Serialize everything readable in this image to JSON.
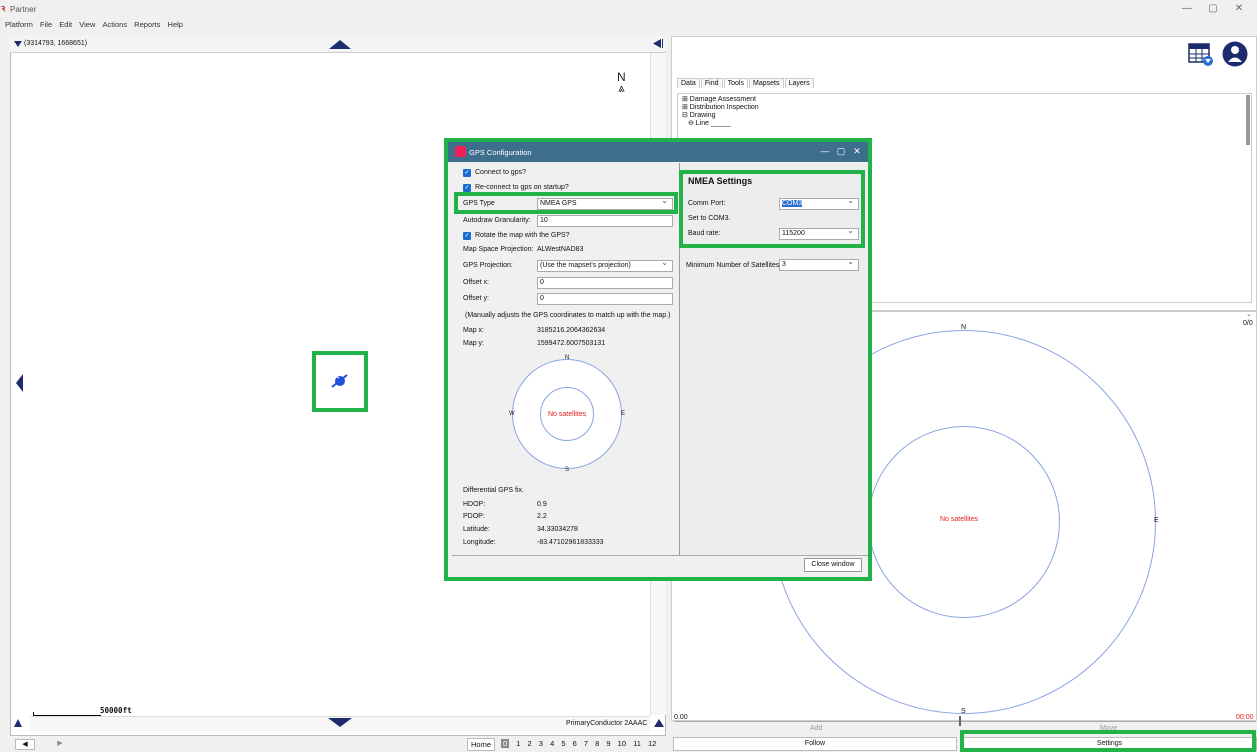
{
  "app": {
    "title": "Partner",
    "menu": [
      "Platform",
      "File",
      "Edit",
      "View",
      "Actions",
      "Reports",
      "Help"
    ],
    "window_controls": {
      "minimize": "—",
      "restore": "▢",
      "close": "✕"
    }
  },
  "map": {
    "coords": "(3314793, 1668651)",
    "north": "N",
    "scale": "50000ft",
    "layer": "PrimaryConductor 2AAAC",
    "home": "Home",
    "pages": [
      "0",
      "1",
      "2",
      "3",
      "4",
      "5",
      "6",
      "7",
      "8",
      "9",
      "10",
      "11",
      "12"
    ],
    "active_page": "0"
  },
  "tools": {
    "tabs": [
      "Data",
      "Find",
      "Tools",
      "Mapsets",
      "Layers"
    ],
    "active_tab": "Tools",
    "tree": [
      "⊞ Damage Assessment",
      "⊞ Distribution Inspection",
      "⊟ Drawing",
      "  ⊖ Line _____"
    ]
  },
  "skyplot_large": {
    "n": "N",
    "s": "S",
    "e": "E",
    "no_sat": "No satellites",
    "count": "0/0",
    "left_val": "0.00",
    "right_val": "00:00",
    "add": "Add",
    "move": "Move",
    "follow": "Follow",
    "settings": "Settings"
  },
  "dialog": {
    "title": "GPS Configuration",
    "connect": "Connect to gps?",
    "reconnect": "Re-connect to gps on startup?",
    "gps_type_label": "GPS Type",
    "gps_type_value": "NMEA GPS",
    "autodraw_label": "Autodraw Granularity:",
    "autodraw_value": "10",
    "rotate": "Rotate the map with the GPS?",
    "map_proj_label": "Map Space Projection:",
    "map_proj_value": "ALWestNAD83",
    "gps_proj_label": "GPS Projection:",
    "gps_proj_value": "(Use the mapset's projection)",
    "offset_x_label": "Offset x:",
    "offset_x_value": "0",
    "offset_y_label": "Offset y:",
    "offset_y_value": "0",
    "offset_note": "(Manually adjusts the GPS coordinates to match up with the map.)",
    "map_x_label": "Map x:",
    "map_x_value": "3185216.2064362634",
    "map_y_label": "Map y:",
    "map_y_value": "1599472.6007503131",
    "sky": {
      "n": "N",
      "s": "S",
      "e": "E",
      "w": "W",
      "no_sat": "No satellites"
    },
    "fix": "Differential GPS fix.",
    "hdop_label": "HDOP:",
    "hdop_value": "0.9",
    "pdop_label": "PDOP:",
    "pdop_value": "2.2",
    "lat_label": "Latitude:",
    "lat_value": "34.33034278",
    "lon_label": "Longitude:",
    "lon_value": "-83.47102961833333",
    "nmea_title": "NMEA Settings",
    "comm_port_label": "Comm Port:",
    "comm_port_value": "COM3",
    "set_to": "Set to COM3.",
    "baud_label": "Baud rate:",
    "baud_value": "115200",
    "min_sat_label": "Minimum Number of Satellites",
    "min_sat_value": "3",
    "close": "Close window"
  },
  "colors": {
    "highlight": "#21b34a",
    "titlebar": "#3d6e8c",
    "checkbox": "#1a6ecf",
    "nav_triangle": "#1c2c6e"
  }
}
